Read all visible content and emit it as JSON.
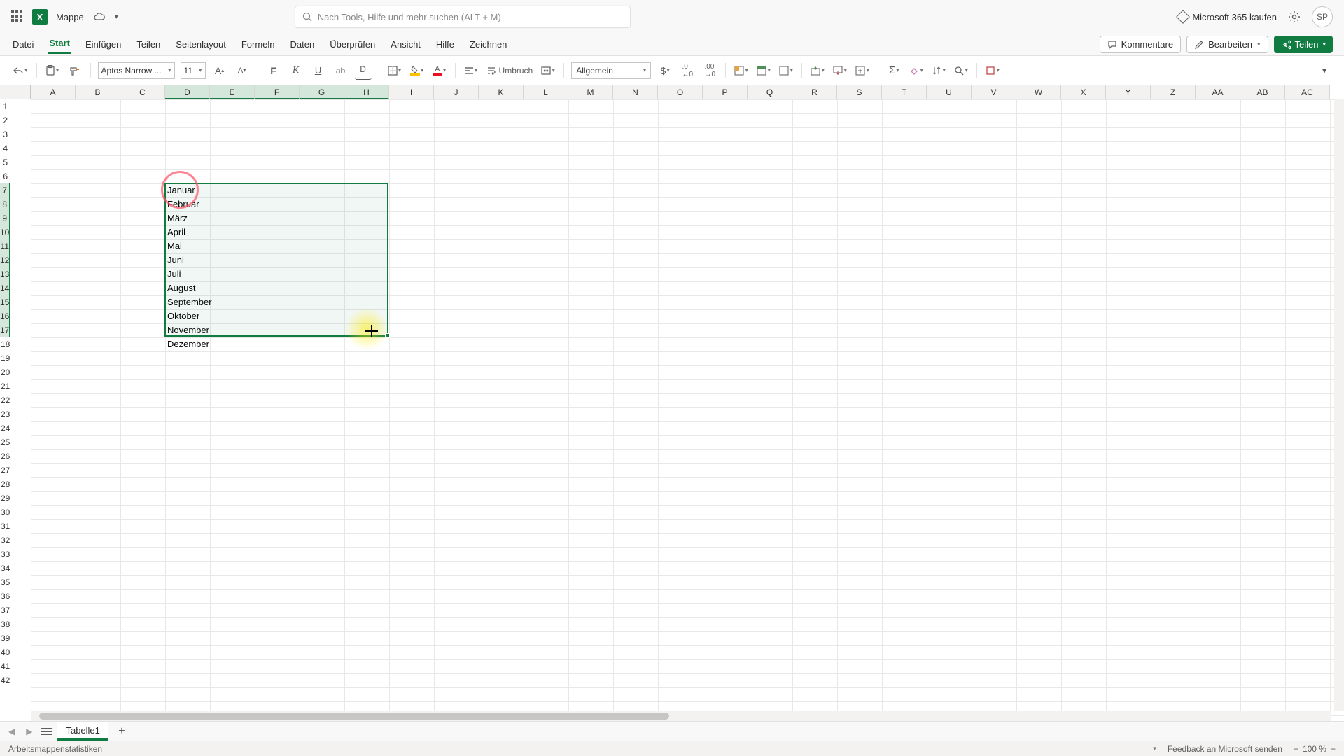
{
  "title": {
    "doc_name": "Mappe"
  },
  "search": {
    "placeholder": "Nach Tools, Hilfe und mehr suchen (ALT + M)"
  },
  "header_right": {
    "buy": "Microsoft 365 kaufen",
    "avatar": "SP"
  },
  "menu": {
    "items": [
      "Datei",
      "Start",
      "Einfügen",
      "Teilen",
      "Seitenlayout",
      "Formeln",
      "Daten",
      "Überprüfen",
      "Ansicht",
      "Hilfe",
      "Zeichnen"
    ],
    "active": "Start",
    "comments": "Kommentare",
    "edit": "Bearbeiten",
    "share": "Teilen"
  },
  "toolbar": {
    "font_name": "Aptos Narrow ...",
    "font_size": "11",
    "wrap": "Umbruch",
    "number_format": "Allgemein"
  },
  "columns": [
    "A",
    "B",
    "C",
    "D",
    "E",
    "F",
    "G",
    "H",
    "I",
    "J",
    "K",
    "L",
    "M",
    "N",
    "O",
    "P",
    "Q",
    "R",
    "S",
    "T",
    "U",
    "V",
    "W",
    "X",
    "Y",
    "Z",
    "AA",
    "AB",
    "AC"
  ],
  "rows": [
    "1",
    "2",
    "3",
    "4",
    "5",
    "6",
    "7",
    "8",
    "9",
    "10",
    "11",
    "12",
    "13",
    "14",
    "15",
    "16",
    "17",
    "18",
    "19",
    "20",
    "21",
    "22",
    "23",
    "24",
    "25",
    "26",
    "27",
    "28",
    "29",
    "30",
    "31",
    "32",
    "33",
    "34",
    "35",
    "36",
    "37",
    "38",
    "39",
    "40",
    "41",
    "42"
  ],
  "selected_cols": [
    "D",
    "E",
    "F",
    "G",
    "H"
  ],
  "selected_rows": [
    "7",
    "8",
    "9",
    "10",
    "11",
    "12",
    "13",
    "14",
    "15",
    "16",
    "17"
  ],
  "cells": [
    {
      "col": "D",
      "row": "7",
      "value": "Januar"
    },
    {
      "col": "D",
      "row": "8",
      "value": "Februar"
    },
    {
      "col": "D",
      "row": "9",
      "value": "März"
    },
    {
      "col": "D",
      "row": "10",
      "value": "April"
    },
    {
      "col": "D",
      "row": "11",
      "value": "Mai"
    },
    {
      "col": "D",
      "row": "12",
      "value": "Juni"
    },
    {
      "col": "D",
      "row": "13",
      "value": "Juli"
    },
    {
      "col": "D",
      "row": "14",
      "value": "August"
    },
    {
      "col": "D",
      "row": "15",
      "value": "September"
    },
    {
      "col": "D",
      "row": "16",
      "value": "Oktober"
    },
    {
      "col": "D",
      "row": "17",
      "value": "November"
    },
    {
      "col": "D",
      "row": "18",
      "value": "Dezember"
    }
  ],
  "selection": {
    "start_col": "D",
    "end_col": "H",
    "start_row": "7",
    "end_row": "17"
  },
  "sheet": {
    "tab": "Tabelle1"
  },
  "status": {
    "left": "Arbeitsmappenstatistiken",
    "feedback": "Feedback an Microsoft senden",
    "zoom": "100 %"
  }
}
